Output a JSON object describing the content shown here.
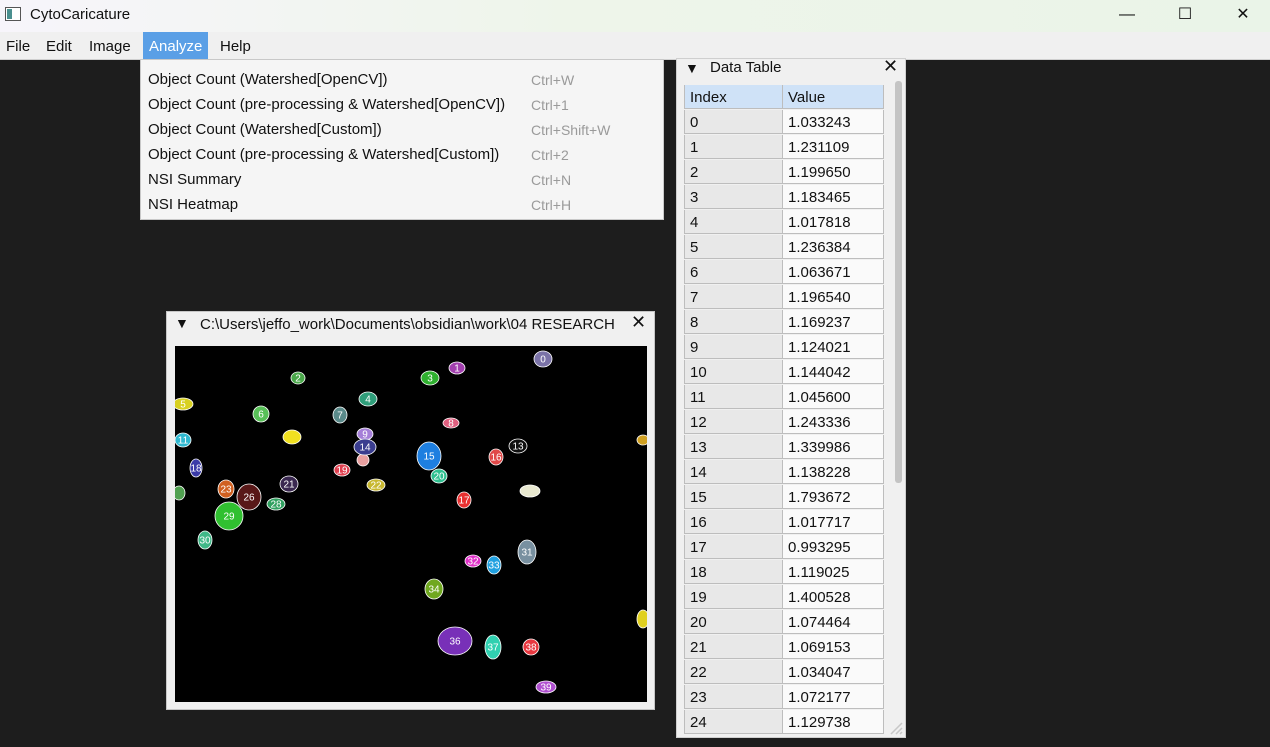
{
  "window": {
    "title": "CytoCaricature",
    "min_icon": "minimize-icon",
    "max_icon": "maximize-icon",
    "close_icon": "close-icon",
    "min_glyph": "—",
    "max_glyph": "☐",
    "close_glyph": "✕"
  },
  "menubar": {
    "items": [
      "File",
      "Edit",
      "Image",
      "Analyze",
      "Help"
    ],
    "active": "Analyze",
    "active_color": "#5a9fe6"
  },
  "analyze_menu": [
    {
      "label": "Object Count (Watershed[OpenCV])",
      "shortcut": "Ctrl+W"
    },
    {
      "label": "Object Count (pre-processing & Watershed[OpenCV])",
      "shortcut": "Ctrl+1"
    },
    {
      "label": "Object Count (Watershed[Custom])",
      "shortcut": "Ctrl+Shift+W"
    },
    {
      "label": "Object Count (pre-processing & Watershed[Custom])",
      "shortcut": "Ctrl+2"
    },
    {
      "label": "NSI Summary",
      "shortcut": "Ctrl+N"
    },
    {
      "label": "NSI Heatmap",
      "shortcut": "Ctrl+H"
    }
  ],
  "data_table": {
    "title": "Data Table",
    "collapse_glyph": "▼",
    "close_glyph": "✕",
    "columns": [
      "Index",
      "Value"
    ],
    "rows": [
      [
        "0",
        "1.033243"
      ],
      [
        "1",
        "1.231109"
      ],
      [
        "2",
        "1.199650"
      ],
      [
        "3",
        "1.183465"
      ],
      [
        "4",
        "1.017818"
      ],
      [
        "5",
        "1.236384"
      ],
      [
        "6",
        "1.063671"
      ],
      [
        "7",
        "1.196540"
      ],
      [
        "8",
        "1.169237"
      ],
      [
        "9",
        "1.124021"
      ],
      [
        "10",
        "1.144042"
      ],
      [
        "11",
        "1.045600"
      ],
      [
        "12",
        "1.243336"
      ],
      [
        "13",
        "1.339986"
      ],
      [
        "14",
        "1.138228"
      ],
      [
        "15",
        "1.793672"
      ],
      [
        "16",
        "1.017717"
      ],
      [
        "17",
        "0.993295"
      ],
      [
        "18",
        "1.119025"
      ],
      [
        "19",
        "1.400528"
      ],
      [
        "20",
        "1.074464"
      ],
      [
        "21",
        "1.069153"
      ],
      [
        "22",
        "1.034047"
      ],
      [
        "23",
        "1.072177"
      ],
      [
        "24",
        "1.129738"
      ]
    ]
  },
  "image_window": {
    "title": "C:\\Users\\jeffo_work\\Documents\\obsidian\\work\\04  RESEARCH",
    "collapse_glyph": "▼",
    "close_glyph": "✕",
    "cells": [
      {
        "label": "0",
        "color": "#7b73a8"
      },
      {
        "label": "1",
        "color": "#a23fae"
      },
      {
        "label": "2",
        "color": "#4aa84a"
      },
      {
        "label": "3",
        "color": "#2fb02f"
      },
      {
        "label": "4",
        "color": "#2f9e7a"
      },
      {
        "label": "5",
        "color": "#d8d020"
      },
      {
        "label": "6",
        "color": "#58c058"
      },
      {
        "label": "7",
        "color": "#5a8a8a"
      },
      {
        "label": "8",
        "color": "#e06080"
      },
      {
        "label": "9",
        "color": "#a57fd8"
      },
      {
        "label": "11",
        "color": "#2fb8d0"
      },
      {
        "label": "13",
        "color": "#101010"
      },
      {
        "label": "14",
        "color": "#3a3d8f"
      },
      {
        "label": "15",
        "color": "#1e7fe0"
      },
      {
        "label": "16",
        "color": "#e04848"
      },
      {
        "label": "17",
        "color": "#e83030"
      },
      {
        "label": "18",
        "color": "#3a3aa8"
      },
      {
        "label": "19",
        "color": "#e04050"
      },
      {
        "label": "20",
        "color": "#30c090"
      },
      {
        "label": "21",
        "color": "#3a2850"
      },
      {
        "label": "22",
        "color": "#c8b830"
      },
      {
        "label": "23",
        "color": "#d06020"
      },
      {
        "label": "26",
        "color": "#581818"
      },
      {
        "label": "28",
        "color": "#30a060"
      },
      {
        "label": "29",
        "color": "#30c030"
      },
      {
        "label": "30",
        "color": "#40b888"
      },
      {
        "label": "31",
        "color": "#7890a0"
      },
      {
        "label": "32",
        "color": "#e030c8"
      },
      {
        "label": "33",
        "color": "#20a0e0"
      },
      {
        "label": "34",
        "color": "#70a820"
      },
      {
        "label": "36",
        "color": "#7830b8"
      },
      {
        "label": "37",
        "color": "#30d0b0"
      },
      {
        "label": "38",
        "color": "#e83840"
      },
      {
        "label": "39",
        "color": "#b050d0"
      }
    ]
  }
}
